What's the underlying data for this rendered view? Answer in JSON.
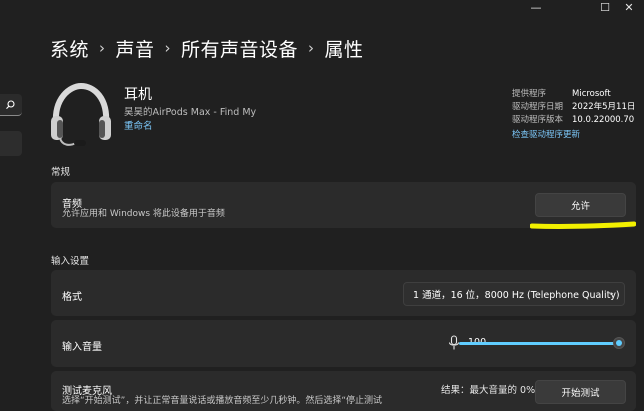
{
  "window": {
    "minimize_glyph": "—",
    "maximize_glyph": "☐",
    "close_glyph": "✕"
  },
  "sidebar": {
    "search_icon": "search-icon"
  },
  "breadcrumb": {
    "items": [
      "系统",
      "声音",
      "所有声音设备",
      "属性"
    ],
    "separator": "›"
  },
  "device": {
    "icon": "headphones-icon",
    "name": "耳机",
    "subtitle": "昊昊的AirPods Max - Find My",
    "rename_label": "重命名",
    "info": {
      "provider_label": "提供程序",
      "provider_value": "Microsoft",
      "date_label": "驱动程序日期",
      "date_value": "2022年5月11日",
      "version_label": "驱动程序版本",
      "version_value": "10.0.22000.70",
      "update_link": "检查驱动程序更新"
    }
  },
  "general": {
    "heading": "常规",
    "audio": {
      "title": "音频",
      "description": "允许应用和 Windows 将此设备用于音频",
      "button_label": "允许"
    }
  },
  "input_settings": {
    "heading": "输入设置",
    "format": {
      "title": "格式",
      "selected": "1 通道，16 位，8000 Hz (Telephone Quality)"
    },
    "volume": {
      "title": "输入音量",
      "value": "100",
      "level": 100,
      "icon": "microphone-icon"
    },
    "test": {
      "title": "测试麦克风",
      "description": "选择“开始测试”，并让正常音量说话或播放音频至少几秒钟。然后选择“停止测试”",
      "result": "结果：最大音量的 0%",
      "button_label": "开始测试"
    }
  },
  "colors": {
    "accent": "#60cdff",
    "annotation": "#f2f000"
  }
}
